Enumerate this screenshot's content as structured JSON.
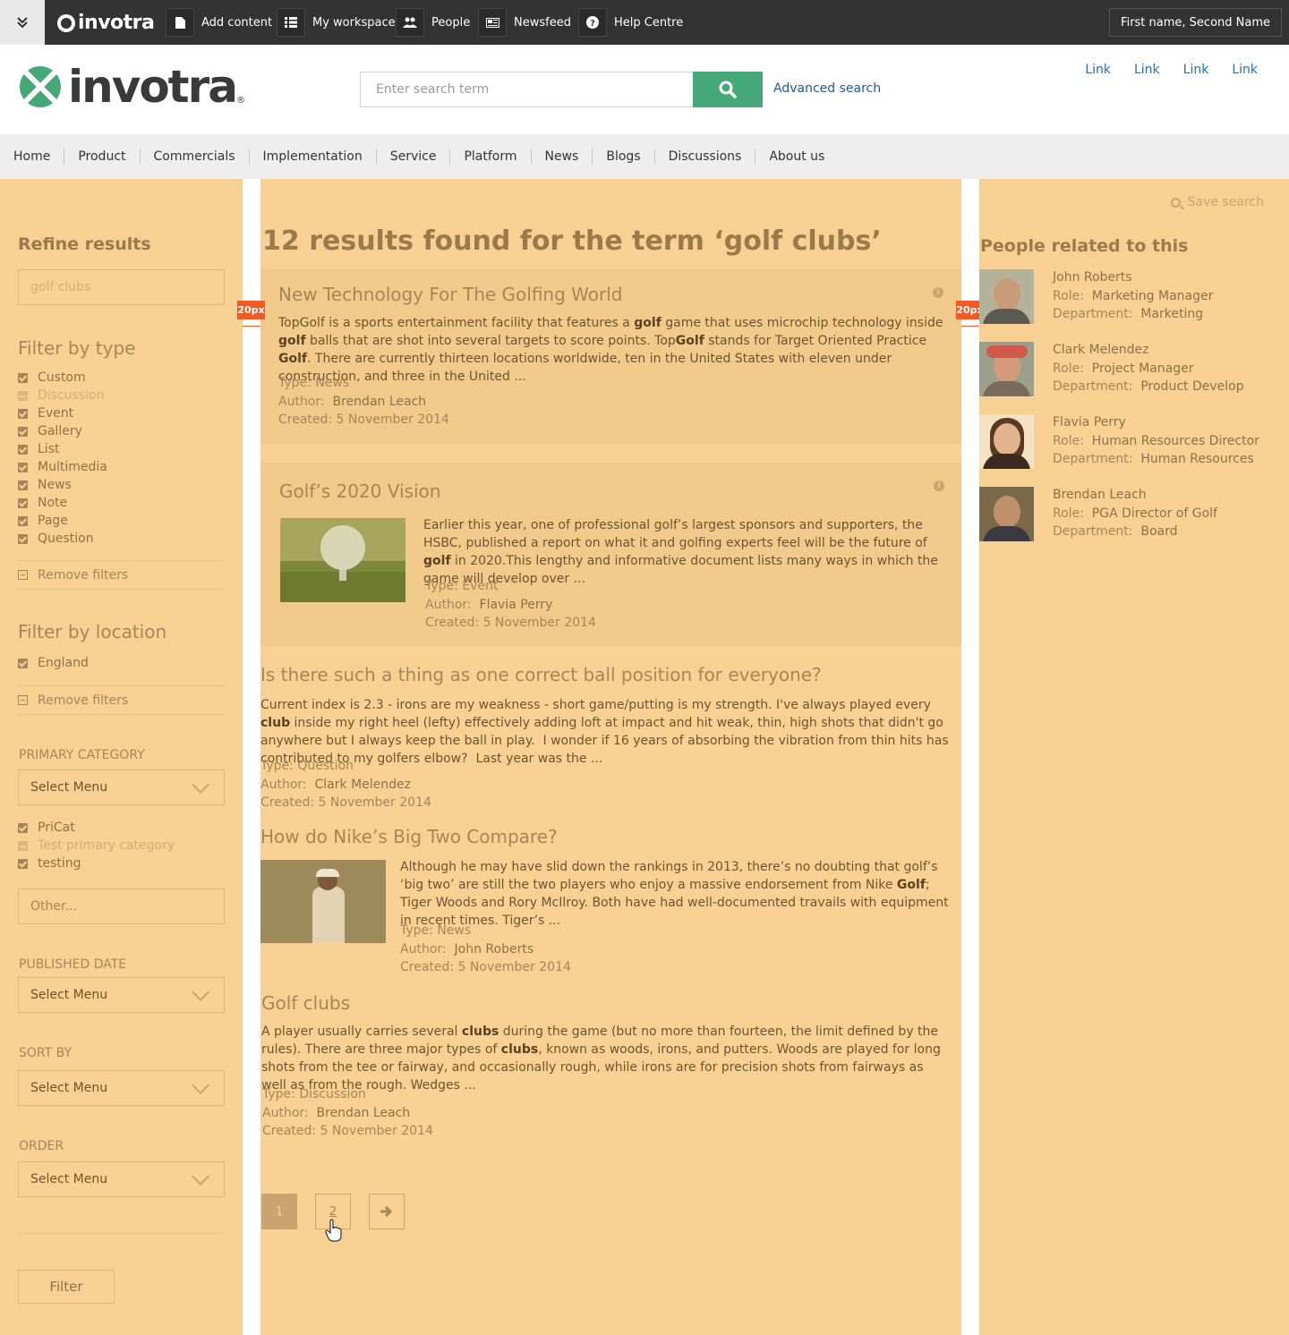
{
  "adminbar": {
    "brand": "invotra",
    "items": [
      {
        "label": "Add content",
        "icon": "document-icon"
      },
      {
        "label": "My workspace",
        "icon": "list-icon"
      },
      {
        "label": "People",
        "icon": "people-icon"
      },
      {
        "label": "Newsfeed",
        "icon": "newspaper-icon"
      },
      {
        "label": "Help Centre",
        "icon": "question-icon"
      }
    ],
    "user": "First name, Second Name"
  },
  "header": {
    "logo": "invotra",
    "search_placeholder": "Enter search term",
    "advanced_search": "Advanced search",
    "links": [
      "Link",
      "Link",
      "Link",
      "Link"
    ]
  },
  "nav": [
    "Home",
    "Product",
    "Commercials",
    "Implementation",
    "Service",
    "Platform",
    "News",
    "Blogs",
    "Discussions",
    "About us"
  ],
  "sidebar": {
    "refine_title": "Refine results",
    "refine_value": "golf clubs",
    "filter_type_title": "Filter by type",
    "types": [
      {
        "label": "Custom",
        "state": "checked"
      },
      {
        "label": "Discussion",
        "state": "indeterminate"
      },
      {
        "label": "Event",
        "state": "checked"
      },
      {
        "label": "Gallery",
        "state": "checked"
      },
      {
        "label": "List",
        "state": "checked"
      },
      {
        "label": "Multimedia",
        "state": "checked"
      },
      {
        "label": "News",
        "state": "checked"
      },
      {
        "label": "Note",
        "state": "checked"
      },
      {
        "label": "Page",
        "state": "checked"
      },
      {
        "label": "Question",
        "state": "checked"
      }
    ],
    "remove_filters": "Remove filters",
    "filter_location_title": "Filter by location",
    "locations": [
      {
        "label": "England",
        "state": "checked"
      }
    ],
    "primary_category_label": "PRIMARY CATEGORY",
    "select_menu": "Select Menu",
    "categories": [
      {
        "label": "PriCat",
        "state": "checked"
      },
      {
        "label": "Test primary category",
        "state": "indeterminate"
      },
      {
        "label": "testing",
        "state": "checked"
      }
    ],
    "other_placeholder": "Other...",
    "published_date_label": "PUBLISHED DATE",
    "sort_by_label": "SORT BY",
    "order_label": "ORDER",
    "filter_button": "Filter"
  },
  "results": {
    "heading": "12 results found for the term ‘golf clubs’",
    "type_label": "Type:",
    "author_label": "Author:",
    "created_label": "Created:",
    "items": [
      {
        "title": "New Technology For The Golfing World",
        "type": "News",
        "author": "Brendan Leach",
        "created": "5 November 2014"
      },
      {
        "title": "Golf’s 2020 Vision",
        "type": "Event",
        "author": "Flavia Perry",
        "created": "5 November 2014"
      },
      {
        "title": "Is there such a thing as one correct ball position for everyone?",
        "type": "Question",
        "author": "Clark Melendez",
        "created": "5 November 2014"
      },
      {
        "title": "How do Nike’s Big Two Compare?",
        "type": "News",
        "author": "John Roberts",
        "created": "5 November 2014"
      },
      {
        "title": "Golf clubs",
        "type": "Discussion",
        "author": "Brendan Leach",
        "created": "5 November 2014"
      }
    ],
    "pagination": {
      "page1": "1",
      "page2": "2",
      "next": "→"
    },
    "spacing_marker": "20px"
  },
  "people": {
    "save_search": "Save search",
    "heading": "People related to this",
    "role_label": "Role:",
    "dept_label": "Department:",
    "list": [
      {
        "name": "John Roberts",
        "role": "Marketing Manager",
        "department": "Marketing"
      },
      {
        "name": "Clark Melendez",
        "role": "Project Manager",
        "department": "Product Develop"
      },
      {
        "name": "Flavia Perry",
        "role": "Human Resources Director",
        "department": "Human Resources"
      },
      {
        "name": "Brendan Leach",
        "role": "PGA Director of Golf",
        "department": "Board"
      }
    ]
  },
  "colors": {
    "overlay": "#f8d093",
    "brand_green": "#45a878",
    "admin_bar": "#333333",
    "highlight_marker": "#f15a24"
  }
}
